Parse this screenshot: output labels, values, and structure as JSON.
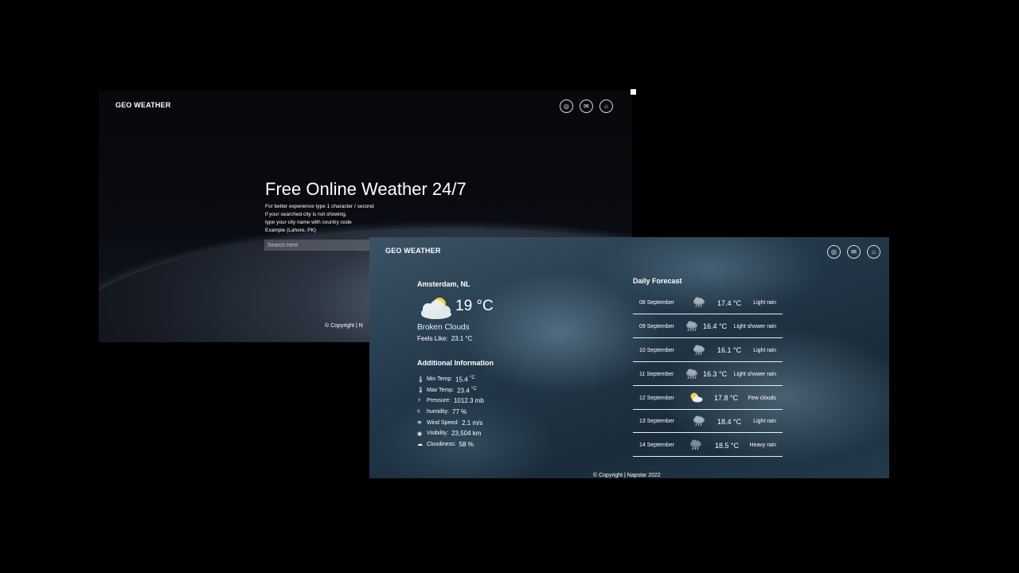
{
  "home_window": {
    "brand": "GEO WEATHER",
    "social_icons": [
      "instagram-icon",
      "mail-icon",
      "github-icon"
    ],
    "title": "Free Online Weather 24/7",
    "tips": [
      "For better experience type 1 character / second",
      "if your searched city is not showing,",
      "type your city name with country code",
      "Example (Lahore, PK)"
    ],
    "search_placeholder": "Search here",
    "footer": "© Copyright | N"
  },
  "weather_window": {
    "brand": "GEO WEATHER",
    "social_icons": [
      "instagram-icon",
      "mail-icon",
      "github-icon"
    ],
    "city": "Amsterdam, NL",
    "current": {
      "icon": "broken-clouds-icon",
      "temp": "19 °C",
      "description": "Broken Clouds",
      "feels_label": "Feels Like:",
      "feels_value": "23.1 °C"
    },
    "additional_title": "Additional Information",
    "additional": [
      {
        "icon": "thermometer-icon",
        "label": "Min Temp:",
        "value": "15.4",
        "unit": "°C"
      },
      {
        "icon": "thermometer-icon",
        "label": "Max Temp:",
        "value": "23.4",
        "unit": "°C"
      },
      {
        "icon": "pressure-icon",
        "label": "Pressure:",
        "value": "1012.3 mb",
        "unit": ""
      },
      {
        "icon": "humidity-icon",
        "label": "humidity:",
        "value": "77 %",
        "unit": ""
      },
      {
        "icon": "wind-icon",
        "label": "Wind Speed:",
        "value": "2.1 m/s",
        "unit": ""
      },
      {
        "icon": "eye-icon",
        "label": "Visibility:",
        "value": "23,504 km",
        "unit": ""
      },
      {
        "icon": "cloud-icon",
        "label": "Cloudiness:",
        "value": "58 %",
        "unit": ""
      }
    ],
    "forecast_title": "Daily Forecast",
    "forecast": [
      {
        "date": "08 September",
        "icon": "rain-icon",
        "temp": "17.4 °C",
        "cond": "Light rain"
      },
      {
        "date": "09 September",
        "icon": "shower-rain-icon",
        "temp": "16.4 °C",
        "cond": "Light shower rain"
      },
      {
        "date": "10 September",
        "icon": "rain-icon",
        "temp": "16.1 °C",
        "cond": "Light rain"
      },
      {
        "date": "11 September",
        "icon": "shower-rain-icon",
        "temp": "16.3 °C",
        "cond": "Light shower rain"
      },
      {
        "date": "12 September",
        "icon": "few-clouds-icon",
        "temp": "17.8 °C",
        "cond": "Few clouds"
      },
      {
        "date": "13 September",
        "icon": "rain-icon",
        "temp": "18.4 °C",
        "cond": "Light rain"
      },
      {
        "date": "14 September",
        "icon": "heavy-rain-icon",
        "temp": "18.5 °C",
        "cond": "Heavy rain"
      }
    ],
    "footer": "© Copyright | Napstar 2022"
  },
  "colors": {
    "sun": "#f2d33a",
    "cloud": "#e9eef2",
    "rain_cloud": "#9aa3ac",
    "divider": "#e8eef3"
  }
}
